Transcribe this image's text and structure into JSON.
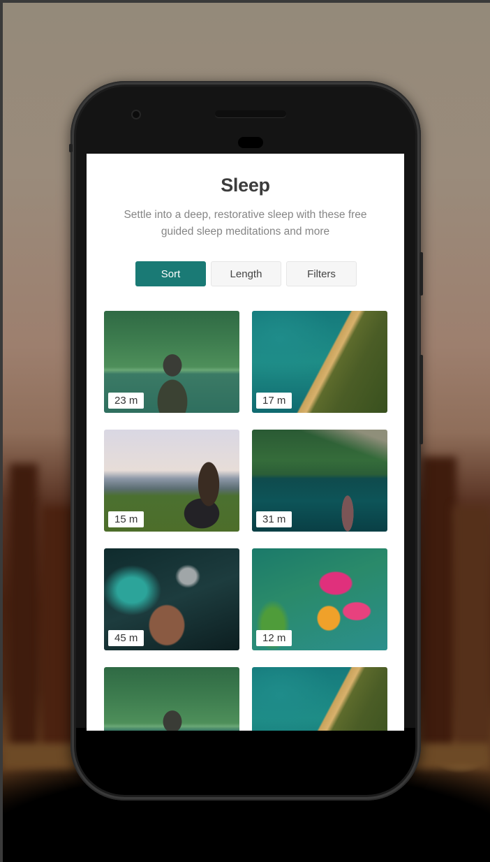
{
  "screen": {
    "title": "Sleep",
    "subtitle": "Settle into a deep, restorative sleep with these free guided sleep meditations and more",
    "accent_color": "#1a7a75"
  },
  "toolbar": {
    "buttons": [
      {
        "label": "Sort",
        "active": true
      },
      {
        "label": "Length",
        "active": false
      },
      {
        "label": "Filters",
        "active": false
      }
    ]
  },
  "meditations": [
    {
      "image": "man-by-forest-lake",
      "duration": "23 m"
    },
    {
      "image": "aerial-coastline",
      "duration": "17 m"
    },
    {
      "image": "woman-sitting-in-field",
      "duration": "15 m"
    },
    {
      "image": "woman-at-mountain-lake",
      "duration": "31 m"
    },
    {
      "image": "man-with-feather-headdress",
      "duration": "45 m"
    },
    {
      "image": "pink-lily-flower",
      "duration": "12 m"
    },
    {
      "image": "man-by-forest-lake",
      "duration": ""
    },
    {
      "image": "aerial-coastline",
      "duration": ""
    }
  ]
}
